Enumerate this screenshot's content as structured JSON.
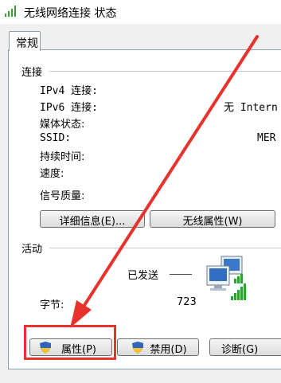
{
  "window": {
    "title": "无线网络连接 状态"
  },
  "tabs": [
    {
      "label": "常规"
    }
  ],
  "connection": {
    "section_label": "连接",
    "ipv4_label": "IPv4 连接:",
    "ipv6_label": "IPv6 连接:",
    "ipv6_value": "无 Intern",
    "media_label": "媒体状态:",
    "ssid_label": "SSID:",
    "ssid_value": "MER",
    "duration_label": "持续时间:",
    "speed_label": "速度:",
    "signal_label": "信号质量:"
  },
  "buttons": {
    "details": "详细信息(E)...",
    "wireless_props": "无线属性(W)",
    "properties": "属性(P)",
    "disable": "禁用(D)",
    "diagnose": "诊断(G)"
  },
  "activity": {
    "section_label": "活动",
    "sent_label": "已发送",
    "bytes_label": "字节:",
    "bytes_sent": "723"
  },
  "colors": {
    "highlight": "#e7322e",
    "signal_green": "#2ea12e"
  },
  "icons": [
    "wifi-signal-icon",
    "network-computers-icon",
    "shield-icon",
    "red-arrow-annotation"
  ]
}
